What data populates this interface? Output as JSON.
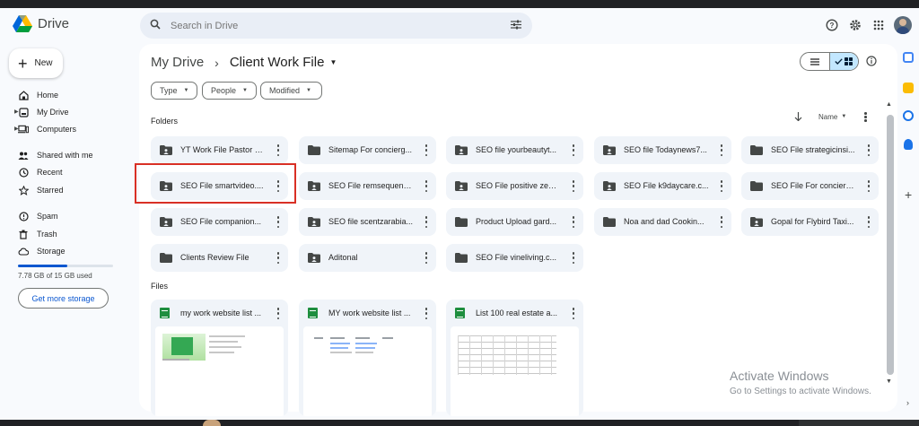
{
  "app": {
    "name": "Drive"
  },
  "search": {
    "placeholder": "Search in Drive"
  },
  "sidebar": {
    "new_label": "New",
    "items": [
      {
        "label": "Home",
        "icon": "home-icon"
      },
      {
        "label": "My Drive",
        "icon": "my-drive-icon"
      },
      {
        "label": "Computers",
        "icon": "computers-icon"
      },
      {
        "label": "Shared with me",
        "icon": "shared-icon"
      },
      {
        "label": "Recent",
        "icon": "clock-icon"
      },
      {
        "label": "Starred",
        "icon": "star-icon"
      },
      {
        "label": "Spam",
        "icon": "spam-icon"
      },
      {
        "label": "Trash",
        "icon": "trash-icon"
      },
      {
        "label": "Storage",
        "icon": "cloud-icon"
      }
    ],
    "storage_text": "7.78 GB of 15 GB used",
    "storage_fraction": 0.52,
    "get_more_label": "Get more storage"
  },
  "breadcrumb": {
    "root": "My Drive",
    "separator": "›",
    "current": "Client Work File"
  },
  "filters": [
    "Type",
    "People",
    "Modified"
  ],
  "sort": {
    "label": "Name"
  },
  "sections": {
    "folders": "Folders",
    "files": "Files"
  },
  "folders": [
    {
      "name": "YT Work File Pastor S...",
      "shared": true
    },
    {
      "name": "Sitemap For concierg...",
      "shared": false
    },
    {
      "name": "SEO file yourbeautyt...",
      "shared": true
    },
    {
      "name": "SEO file Todaynews7...",
      "shared": true
    },
    {
      "name": "SEO File strategicinsi...",
      "shared": false
    },
    {
      "name": "SEO File smartvideo....",
      "shared": true
    },
    {
      "name": "SEO File remsequenc...",
      "shared": true
    },
    {
      "name": "SEO File positive zen ...",
      "shared": true
    },
    {
      "name": "SEO File k9daycare.c...",
      "shared": true
    },
    {
      "name": "SEO File For concierg...",
      "shared": false
    },
    {
      "name": "SEO File companion...",
      "shared": true
    },
    {
      "name": "SEO file scentzarabia...",
      "shared": true
    },
    {
      "name": "Product Upload gard...",
      "shared": false
    },
    {
      "name": "Noa and dad Cookin...",
      "shared": false
    },
    {
      "name": "Gopal for Flybird Taxi...",
      "shared": true
    },
    {
      "name": "Clients Review File",
      "shared": false
    },
    {
      "name": "Aditonal",
      "shared": true
    },
    {
      "name": "SEO File vineliving.c...",
      "shared": false
    }
  ],
  "files": [
    {
      "name": "my work website list ..."
    },
    {
      "name": "MY work website list ..."
    },
    {
      "name": "List 100 real estate a..."
    }
  ],
  "watermark": {
    "line1": "Activate Windows",
    "line2": "Go to Settings to activate Windows."
  },
  "colors": {
    "accent": "#0b57d0",
    "highlight": "#d93025",
    "sheets": "#1e8e3e",
    "folder": "#444746"
  }
}
